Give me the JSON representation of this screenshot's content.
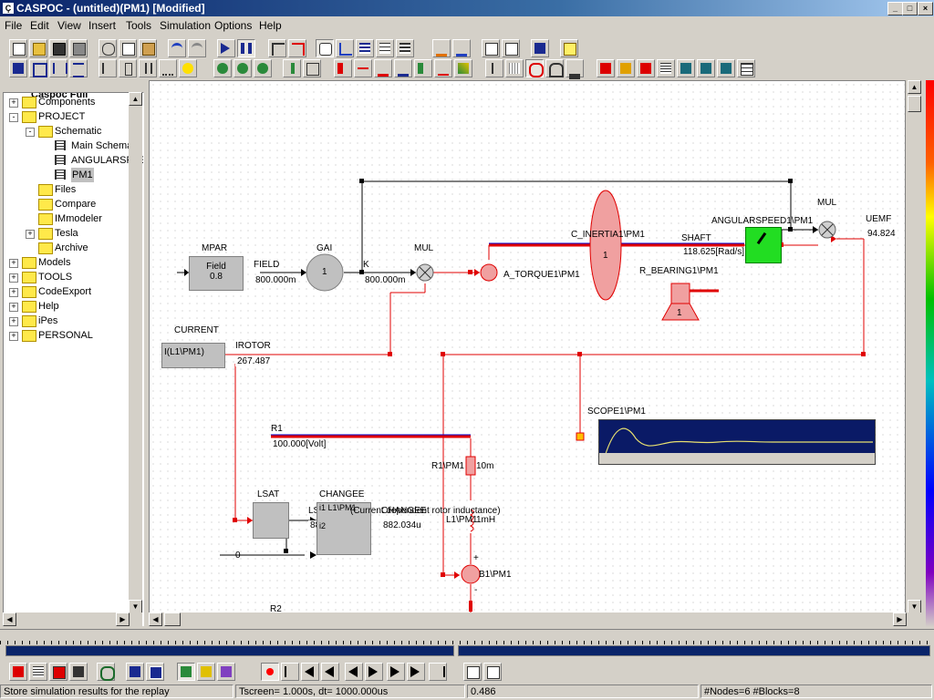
{
  "window": {
    "title": "CASPOC - (untitled)(PM1) [Modified]",
    "controls": [
      "_",
      "□",
      "×"
    ]
  },
  "menu": [
    "File",
    "Edit",
    "View",
    "Insert",
    "Tools",
    "Simulation",
    "Options",
    "Help"
  ],
  "tree": {
    "header": "Caspoc Full",
    "items": [
      {
        "label": "Components",
        "indent": 0,
        "expand": "+",
        "icon": "folder"
      },
      {
        "label": "PROJECT",
        "indent": 0,
        "expand": "-",
        "icon": "folder"
      },
      {
        "label": "Schematic",
        "indent": 1,
        "expand": "-",
        "icon": "folder"
      },
      {
        "label": "Main Schematic",
        "indent": 2,
        "expand": "",
        "icon": "schematic"
      },
      {
        "label": "ANGULARSPEED",
        "indent": 2,
        "expand": "",
        "icon": "schematic"
      },
      {
        "label": "PM1",
        "indent": 2,
        "expand": "",
        "icon": "schematic",
        "selected": true
      },
      {
        "label": "Files",
        "indent": 1,
        "expand": "",
        "icon": "folder"
      },
      {
        "label": "Compare",
        "indent": 1,
        "expand": "",
        "icon": "folder"
      },
      {
        "label": "IMmodeler",
        "indent": 1,
        "expand": "",
        "icon": "folder"
      },
      {
        "label": "Tesla",
        "indent": 1,
        "expand": "+",
        "icon": "folder"
      },
      {
        "label": "Archive",
        "indent": 1,
        "expand": "",
        "icon": "folder"
      },
      {
        "label": "Models",
        "indent": 0,
        "expand": "+",
        "icon": "folder"
      },
      {
        "label": "TOOLS",
        "indent": 0,
        "expand": "+",
        "icon": "folder"
      },
      {
        "label": "CodeExport",
        "indent": 0,
        "expand": "+",
        "icon": "folder"
      },
      {
        "label": "Help",
        "indent": 0,
        "expand": "+",
        "icon": "folder"
      },
      {
        "label": "iPes",
        "indent": 0,
        "expand": "+",
        "icon": "folder"
      },
      {
        "label": "PERSONAL",
        "indent": 0,
        "expand": "+",
        "icon": "folder"
      }
    ]
  },
  "schematic": {
    "mpar": {
      "name": "MPAR",
      "line1": "Field",
      "line2": "0.8"
    },
    "field": {
      "name": "FIELD",
      "value": "800.000m"
    },
    "gai": {
      "name": "GAI",
      "value": "1"
    },
    "k": {
      "name": "K",
      "value": "800.000m"
    },
    "mul1": {
      "name": "MUL"
    },
    "a_torque": {
      "name": "A_TORQUE1\\PM1"
    },
    "c_inertia": {
      "name": "C_INERTIA1\\PM1",
      "value": "1"
    },
    "shaft": {
      "name": "SHAFT",
      "value": "118.625[Rad/s]"
    },
    "r_bearing": {
      "name": "R_BEARING1\\PM1",
      "value": "1"
    },
    "angularspeed": {
      "name": "ANGULARSPEED1\\PM1"
    },
    "mul2": {
      "name": "MUL"
    },
    "uemf": {
      "name": "UEMF",
      "value": "94.824"
    },
    "current": {
      "name": "CURRENT",
      "text": "I(L1\\PM1)"
    },
    "irotor": {
      "name": "IROTOR",
      "value": "267.487"
    },
    "r1": {
      "name": "R1",
      "value": "100.000[Volt]"
    },
    "scope": {
      "name": "SCOPE1\\PM1"
    },
    "r1pm1": {
      "name": "R1\\PM1",
      "value": "10m"
    },
    "lsat": {
      "name": "LSAT"
    },
    "lsat1": {
      "name": "LSAT1",
      "value": "882.034u"
    },
    "changee": {
      "name": "CHANGEE",
      "in1": "i1 L1\\PM1",
      "in2": "i2",
      "value": "882.034u",
      "note": "(Current dependent rotor inductance)",
      "overlap": "CHANGEE"
    },
    "l1pm1": {
      "name": "L1\\PM1",
      "value": "1mH"
    },
    "zero": {
      "value": "0"
    },
    "b1pm1": {
      "name": "B1\\PM1",
      "plus": "+",
      "minus": "-"
    },
    "r2": {
      "name": "R2"
    }
  },
  "status": {
    "message": "Store simulation results for the replay",
    "tscreen": "Tscreen= 1.000s, dt= 1000.000us",
    "value": "0.486",
    "counts": "#Nodes=6 #Blocks=8"
  },
  "colors": {
    "wire_black": "#000000",
    "wire_red": "#e00000",
    "node_blue": "#0000cc",
    "scope_bg": "#0a1a66",
    "scope_trace": "#e8e070",
    "angular_green": "#22dd22",
    "block_gray": "#c0c0c0"
  }
}
